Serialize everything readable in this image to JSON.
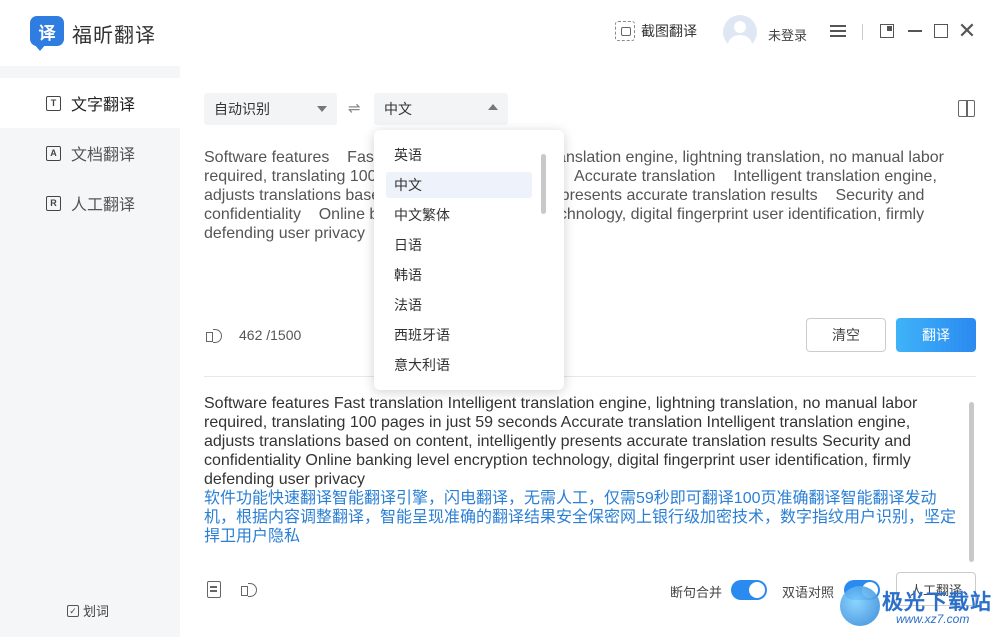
{
  "app": {
    "logo_char": "译",
    "name": "福昕翻译",
    "screenshot_label": "截图翻译",
    "login_label": "未登录"
  },
  "sidebar": {
    "items": [
      {
        "icon_char": "T",
        "label": "文字翻译",
        "active": true
      },
      {
        "icon_char": "A",
        "label": "文档翻译",
        "active": false
      },
      {
        "icon_char": "R",
        "label": "人工翻译",
        "active": false
      }
    ],
    "hua_ci_label": "划词"
  },
  "toolbar": {
    "source_lang": "自动识别",
    "swap_symbol": "⇌",
    "target_lang": "中文"
  },
  "source": {
    "text": "Software features    Fast translation    Intelligent translation engine, lightning translation, no manual labor required, translating 100 pages in just 59 seconds    Accurate translation    Intelligent translation engine, adjusts translations based on content, intelligently presents accurate translation results    Security and confidentiality    Online banking level encryption technology, digital fingerprint user identification, firmly defending user privacy",
    "char_count": "462 /1500",
    "clear_label": "清空",
    "translate_label": "翻译"
  },
  "result": {
    "original": "Software features    Fast translation    Intelligent translation engine, lightning translation, no manual labor required, translating 100 pages in just 59 seconds    Accurate translation    Intelligent translation engine, adjusts translations based on content, intelligently presents accurate translation results    Security and confidentiality    Online banking level encryption technology, digital fingerprint user identification, firmly defending user privacy",
    "translated": "软件功能快速翻译智能翻译引擎，闪电翻译，无需人工，仅需59秒即可翻译100页准确翻译智能翻译发动机，根据内容调整翻译，智能呈现准确的翻译结果安全保密网上银行级加密技术，数字指纹用户识别，坚定捍卫用户隐私",
    "merge_label": "断句合并",
    "bilingual_label": "双语对照",
    "human_label": "人工翻译"
  },
  "dropdown": {
    "options": [
      "英语",
      "中文",
      "中文繁体",
      "日语",
      "韩语",
      "法语",
      "西班牙语",
      "意大利语"
    ],
    "selected": "中文"
  },
  "watermark": {
    "text": "极光下载站",
    "url": "www.xz7.com"
  },
  "colors": {
    "accent": "#2b8af0",
    "translated_text": "#2a7fd4",
    "sidebar_bg": "#f5f6f8"
  }
}
